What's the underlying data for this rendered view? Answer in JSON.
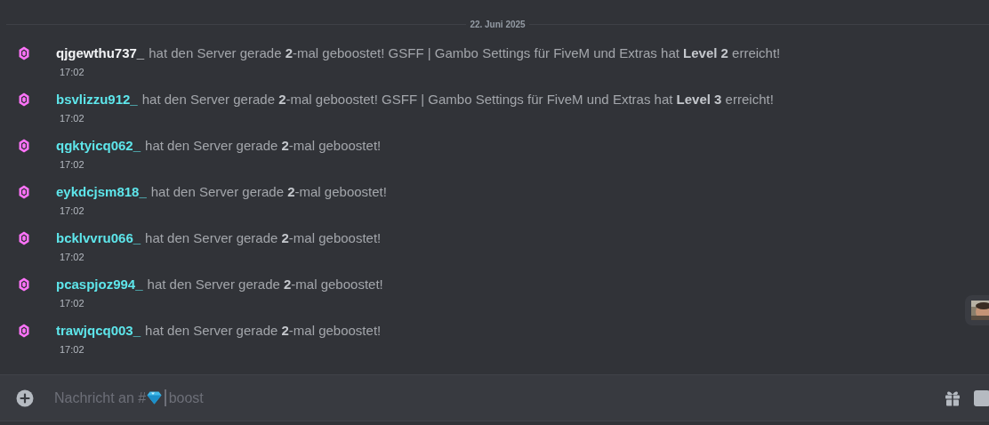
{
  "date_divider": "22. Juni 2025",
  "messages": [
    {
      "username": "qjgewthu737_",
      "color": "#f2f3f5",
      "text": "hat den Server gerade **2**-mal geboostet! GSFF | Gambo Settings für FiveM und Extras hat **Level 2** erreicht!",
      "time": "17:02"
    },
    {
      "username": "bsvlizzu912_",
      "color": "#5ee6eb",
      "text": "hat den Server gerade **2**-mal geboostet! GSFF | Gambo Settings für FiveM und Extras hat **Level 3** erreicht!",
      "time": "17:02"
    },
    {
      "username": "qgktyicq062_",
      "color": "#5ee6eb",
      "text": "hat den Server gerade **2**-mal geboostet!",
      "time": "17:02"
    },
    {
      "username": "eykdcjsm818_",
      "color": "#5ee6eb",
      "text": "hat den Server gerade **2**-mal geboostet!",
      "time": "17:02"
    },
    {
      "username": "bcklvvru066_",
      "color": "#5ee6eb",
      "text": "hat den Server gerade **2**-mal geboostet!",
      "time": "17:02"
    },
    {
      "username": "pcaspjoz994_",
      "color": "#5ee6eb",
      "text": "hat den Server gerade **2**-mal geboostet!",
      "time": "17:02"
    },
    {
      "username": "trawjqcq003_",
      "color": "#5ee6eb",
      "text": "hat den Server gerade **2**-mal geboostet!",
      "time": "17:02"
    }
  ],
  "composer": {
    "placeholder_prefix": "Nachricht an #",
    "channel_name": "boost"
  }
}
